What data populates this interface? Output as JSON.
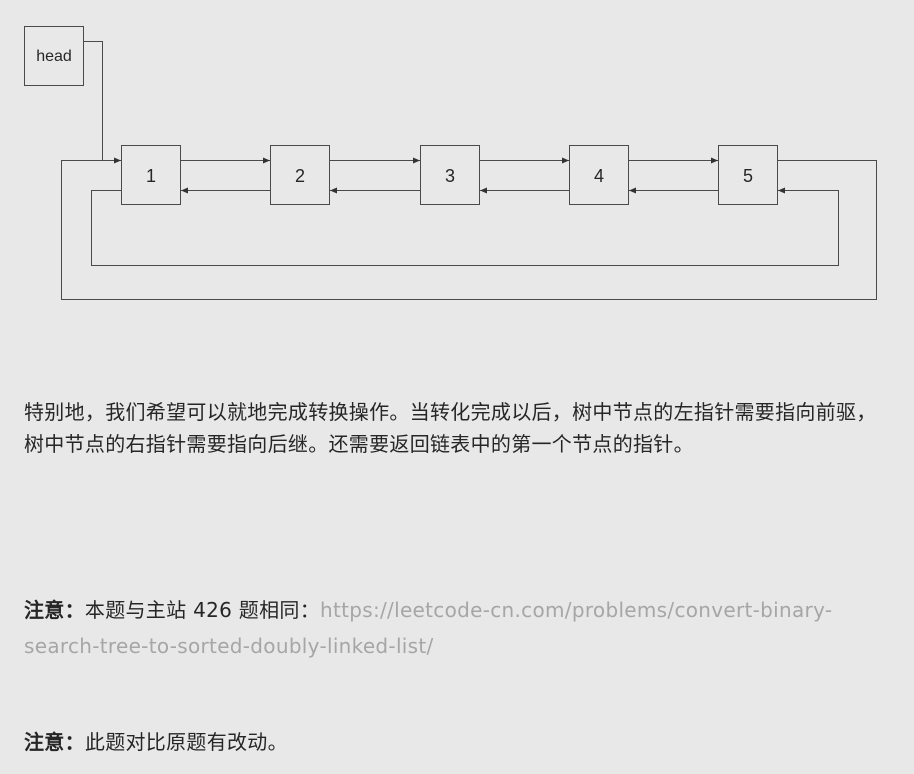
{
  "diagram": {
    "head_label": "head",
    "nodes": [
      "1",
      "2",
      "3",
      "4",
      "5"
    ],
    "colors": {
      "stroke": "#4a4a4a",
      "node_fill": "#e8e8e8"
    }
  },
  "paragraphs": {
    "description": "特别地，我们希望可以就地完成转换操作。当转化完成以后，树中节点的左指针需要指向前驱，树中节点的右指针需要指向后继。还需要返回链表中的第一个节点的指针。",
    "note1": {
      "label": "注意：",
      "text": "本题与主站 426 题相同：",
      "link": "https://leetcode-cn.com/problems/convert-binary-search-tree-to-sorted-doubly-linked-list/"
    },
    "note2": {
      "label": "注意：",
      "text": "此题对比原题有改动。"
    }
  }
}
